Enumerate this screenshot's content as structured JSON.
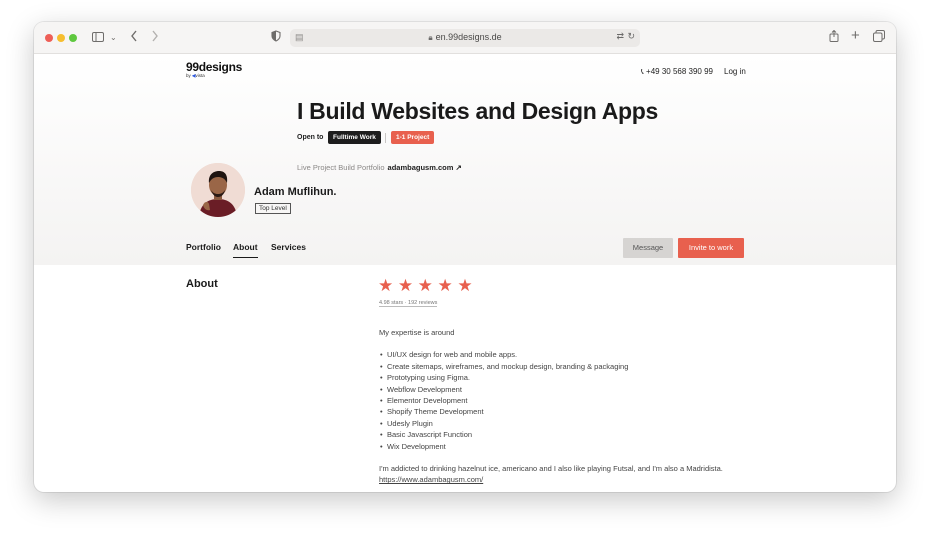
{
  "browser": {
    "url": "en.99designs.de"
  },
  "site": {
    "logo_word": "99designs",
    "logo_by": "by",
    "logo_brand": "vista",
    "phone": "+49 30 568 390 99",
    "login": "Log in"
  },
  "profile": {
    "title": "I Build Websites and Design Apps",
    "open_to_label": "Open to",
    "badges": [
      "Fulltime Work",
      "1-1 Project"
    ],
    "portfolio_label": "Live Project Build Portfolio",
    "portfolio_site": "adambagusm.com ↗",
    "name": "Adam Muflihun.",
    "level": "Top Level"
  },
  "tabs": [
    {
      "label": "Portfolio"
    },
    {
      "label": "About"
    },
    {
      "label": "Services"
    }
  ],
  "actions": {
    "message": "Message",
    "invite": "Invite to work"
  },
  "about": {
    "heading": "About",
    "stars": "★★★★★",
    "rating": 4.98,
    "reviews": "4.98 stars · 192 reviews",
    "intro": "My expertise is around",
    "skills": [
      "UI/UX design for web and mobile apps.",
      "Create sitemaps, wireframes, and mockup design, branding & packaging",
      "Prototyping using Figma.",
      "Webflow Development",
      "Elementor Development",
      "Shopify Theme Development",
      "Udesly Plugin",
      "Basic Javascript Function",
      "Wix Development"
    ],
    "closing": "I'm addicted to drinking hazelnut ice, americano and I also like playing Futsal, and I'm also a Madridista.",
    "link": "https://www.adambagusm.com/"
  },
  "colors": {
    "accent": "#e8604e",
    "dark_badge": "#1d1d1d"
  }
}
